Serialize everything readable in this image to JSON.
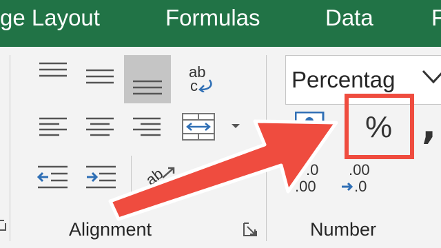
{
  "tabs": [
    {
      "label": "ge Layout"
    },
    {
      "label": "Formulas"
    },
    {
      "label": "Data"
    },
    {
      "label": "F"
    }
  ],
  "groups": {
    "alignment_label": "Alignment",
    "number_label": "Number"
  },
  "number_format": {
    "value": "Percentag"
  },
  "buttons": {
    "percent_glyph": "%",
    "comma_glyph": ","
  },
  "decimal": {
    "increase_top": ".0",
    "increase_bottom": ".00",
    "decrease_top": ".00",
    "decrease_bottom": ".0"
  },
  "wrap_text": {
    "top": "ab",
    "bottom": "c"
  },
  "orientation_glyph": "ab",
  "colors": {
    "ribbon_tab_bg": "#217346",
    "ribbon_bg": "#f3f3f3",
    "highlight_red": "#ef4c3f",
    "icon_blue": "#2f6fb5"
  }
}
